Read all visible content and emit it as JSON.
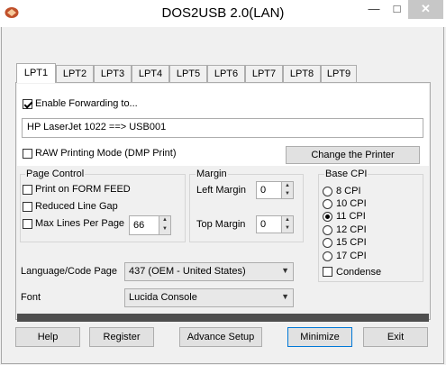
{
  "window": {
    "title": "DOS2USB 2.0(LAN)",
    "min_glyph": "—",
    "max_glyph": "□",
    "close_glyph": "✕"
  },
  "tabs": [
    "LPT1",
    "LPT2",
    "LPT3",
    "LPT4",
    "LPT5",
    "LPT6",
    "LPT7",
    "LPT8",
    "LPT9"
  ],
  "active_tab": "LPT1",
  "forwarding": {
    "enable_label": "Enable Forwarding to...",
    "enabled": true,
    "printer_value": "HP LaserJet 1022 ==> USB001"
  },
  "raw_mode": {
    "label": "RAW Printing Mode (DMP Print)",
    "checked": false
  },
  "change_printer_label": "Change the Printer",
  "page_control": {
    "title": "Page Control",
    "print_on_ff": "Print on FORM FEED",
    "reduced_gap": "Reduced Line Gap",
    "max_lines_label": "Max Lines Per Page",
    "max_lines_value": "66"
  },
  "margin": {
    "title": "Margin",
    "left_label": "Left Margin",
    "left_value": "0",
    "top_label": "Top Margin",
    "top_value": "0"
  },
  "base_cpi": {
    "title": "Base CPI",
    "options": [
      "8 CPI",
      "10 CPI",
      "11 CPI",
      "12 CPI",
      "15 CPI",
      "17 CPI"
    ],
    "selected": "11 CPI",
    "condense_label": "Condense"
  },
  "language": {
    "label": "Language/Code Page",
    "value": "437  (OEM - United States)"
  },
  "font": {
    "label": "Font",
    "value": "Lucida Console"
  },
  "buttons": {
    "help": "Help",
    "register": "Register",
    "advance": "Advance Setup",
    "minimize": "Minimize",
    "exit": "Exit"
  },
  "colors": {
    "accent": "#0078d7",
    "divider": "#4e4e4e",
    "close_bg": "#c7c7c7"
  }
}
